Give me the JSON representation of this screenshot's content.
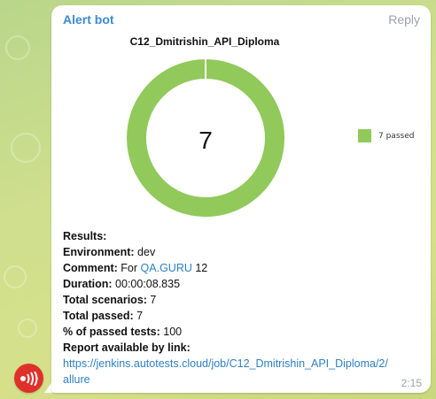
{
  "message": {
    "sender": "Alert bot",
    "reply_label": "Reply",
    "time": "2:15"
  },
  "chart": {
    "title": "C12_Dmitrishin_API_Diploma",
    "center_value": "7",
    "legend_label": "7 passed",
    "ring_color": "#91c95b"
  },
  "chart_data": {
    "type": "pie",
    "title": "C12_Dmitrishin_API_Diploma",
    "series": [
      {
        "name": "7 passed",
        "value": 7
      }
    ],
    "center_label": "7",
    "legend_position": "right"
  },
  "report": {
    "results_label": "Results:",
    "environment_label": "Environment:",
    "environment_value": "dev",
    "comment_label": "Comment:",
    "comment_prefix": "For",
    "comment_link": "QA.GURU",
    "comment_suffix": "12",
    "duration_label": "Duration:",
    "duration_value": "00:00:08.835",
    "total_scenarios_label": "Total scenarios:",
    "total_scenarios_value": "7",
    "total_passed_label": "Total passed:",
    "total_passed_value": "7",
    "percent_label": "% of passed tests:",
    "percent_value": "100",
    "report_link_label": "Report available by link:",
    "report_url_line1": "https://jenkins.autotests.cloud/job/C12_Dmitrishin_API_Diploma/2/",
    "report_url_line2": "allure"
  },
  "colors": {
    "accent": "#3a8bd0",
    "avatar": "#e0302a",
    "ring": "#91c95b"
  }
}
